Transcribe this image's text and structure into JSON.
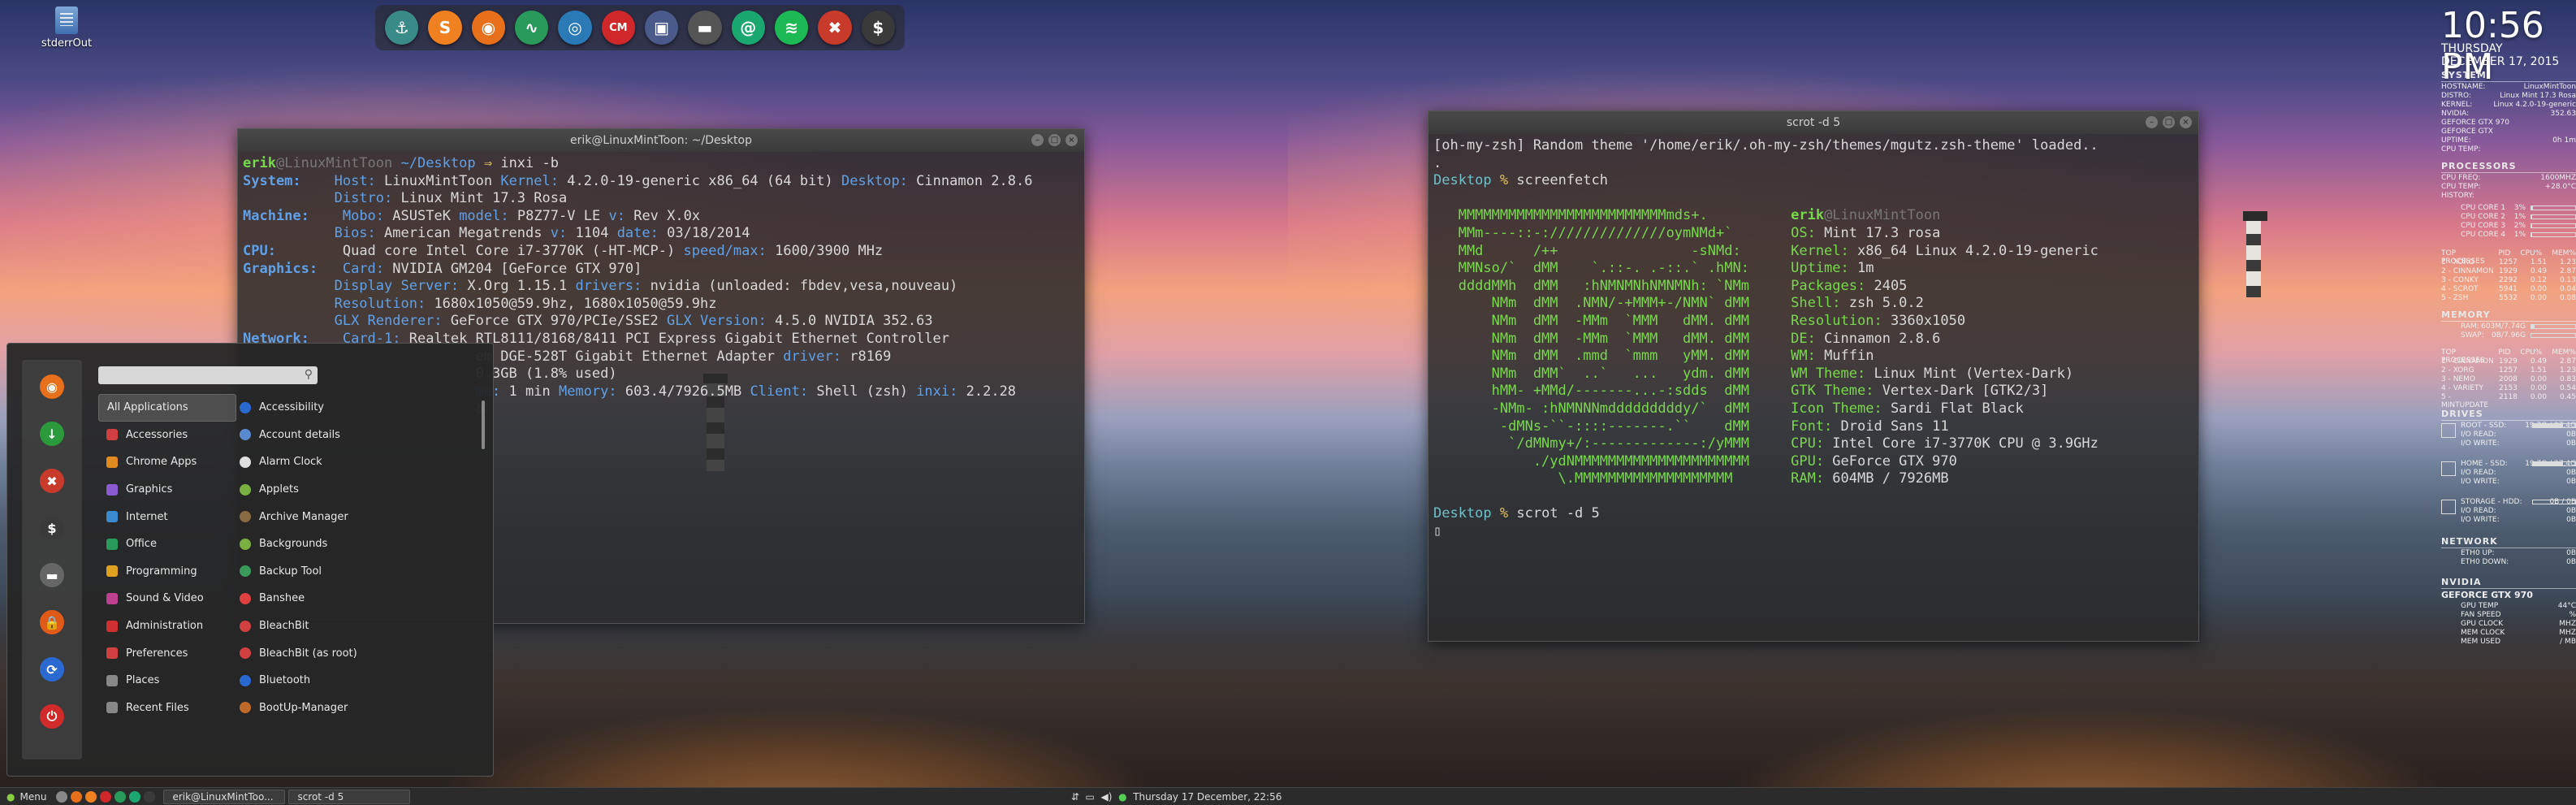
{
  "desktop": {
    "icon_label": "stderrOut"
  },
  "dock": {
    "icons": [
      {
        "name": "anchor-icon",
        "glyph": "⚓",
        "color": "#3a8a8a"
      },
      {
        "name": "sublime-icon",
        "glyph": "S",
        "color": "#f08020"
      },
      {
        "name": "firefox-icon",
        "glyph": "◉",
        "color": "#e8701a"
      },
      {
        "name": "system-monitor-icon",
        "glyph": "∿",
        "color": "#2a9a5a"
      },
      {
        "name": "camera-icon",
        "glyph": "◎",
        "color": "#2a7ab8"
      },
      {
        "name": "cm-icon",
        "glyph": "CM",
        "color": "#d0282a"
      },
      {
        "name": "screenshot-icon",
        "glyph": "▣",
        "color": "#4a5a8a"
      },
      {
        "name": "folder-icon",
        "glyph": "▬",
        "color": "#555555"
      },
      {
        "name": "email-icon",
        "glyph": "@",
        "color": "#1aa870"
      },
      {
        "name": "spotify-icon",
        "glyph": "≋",
        "color": "#1db954"
      },
      {
        "name": "tools-icon",
        "glyph": "✖",
        "color": "#c83a2a"
      },
      {
        "name": "terminal-icon",
        "glyph": "$",
        "color": "#3a3a3a"
      }
    ]
  },
  "term_left": {
    "title": "erik@LinuxMintToon: ~/Desktop",
    "prompt_user": "erik",
    "prompt_host": "@LinuxMintToon",
    "prompt_dir": " ~/Desktop ",
    "prompt_arrow": "⇒",
    "cmd": " inxi -b",
    "sys_label": "System:",
    "host_k": "Host:",
    "host_v": "LinuxMintToon",
    "kernel_k": "Kernel:",
    "kernel_v": "4.2.0-19-generic x86_64 (64 bit)",
    "desktop_k": "Desktop:",
    "desktop_v": "Cinnamon 2.8.6",
    "distro_k": "Distro:",
    "distro_v": "Linux Mint 17.3 Rosa",
    "mach_label": "Machine:",
    "mobo_k": "Mobo:",
    "mobo_v": "ASUSTeK",
    "model_k": "model:",
    "model_v": "P8Z77-V LE",
    "v_k": "v:",
    "v_v": "Rev X.0x",
    "bios_k": "Bios:",
    "bios_v": "American Megatrends",
    "bv_k": "v:",
    "bv_v": "1104",
    "date_k": "date:",
    "date_v": "03/18/2014",
    "cpu_label": "CPU:",
    "cpu_v": "Quad core Intel Core i7-3770K (-HT-MCP-)",
    "speed_k": "speed/max:",
    "speed_v": "1600/3900 MHz",
    "gfx_label": "Graphics:",
    "card_k": "Card:",
    "card_v": "NVIDIA GM204 [GeForce GTX 970]",
    "ds_k": "Display Server:",
    "ds_v": "X.Org 1.15.1",
    "drv_k": "drivers:",
    "drv_v": "nvidia (unloaded: fbdev,vesa,nouveau)",
    "res_k": "Resolution:",
    "res_v": "1680x1050@59.9hz, 1680x1050@59.9hz",
    "glx_k": "GLX Renderer:",
    "glx_v": "GeForce GTX 970/PCIe/SSE2",
    "glxv_k": "GLX Version:",
    "glxv_v": "4.5.0 NVIDIA 352.63",
    "net_label": "Network:",
    "card1_k": "Card-1:",
    "card1_v": "Realtek RTL8111/8168/8411 PCI Express Gigabit Ethernet Controller",
    "card2_v": "em DGE-528T Gigabit Ethernet Adapter",
    "card2_drv_k": "driver:",
    "card2_drv_v": "r8169",
    "hdd_v": "0.3GB (1.8% used)",
    "uptime_k": "me:",
    "uptime_v": "1 min",
    "mem_k": "Memory:",
    "mem_v": "603.4/7926.5MB",
    "client_k": "Client:",
    "client_v": "Shell (zsh)",
    "inxi_k": "inxi:",
    "inxi_v": "2.2.28"
  },
  "menu": {
    "categories": [
      "All Applications",
      "Accessories",
      "Chrome Apps",
      "Graphics",
      "Internet",
      "Office",
      "Programming",
      "Sound & Video",
      "Administration",
      "Preferences",
      "Places",
      "Recent Files"
    ],
    "apps": [
      "Accessibility",
      "Account details",
      "Alarm Clock",
      "Applets",
      "Archive Manager",
      "Backgrounds",
      "Backup Tool",
      "Banshee",
      "BleachBit",
      "BleachBit (as root)",
      "Bluetooth",
      "BootUp-Manager"
    ],
    "favorites": [
      {
        "name": "firefox-fav-icon",
        "glyph": "◉",
        "color": "#e8701a"
      },
      {
        "name": "download-fav-icon",
        "glyph": "↓",
        "color": "#2a9a3a"
      },
      {
        "name": "tools-fav-icon",
        "glyph": "✖",
        "color": "#c83a2a"
      },
      {
        "name": "terminal-fav-icon",
        "glyph": "$",
        "color": "#3a3a3a"
      },
      {
        "name": "files-fav-icon",
        "glyph": "▬",
        "color": "#666666"
      },
      {
        "name": "lock-fav-icon",
        "glyph": "🔒",
        "color": "#e05a1a"
      },
      {
        "name": "logout-fav-icon",
        "glyph": "⟳",
        "color": "#2a6ad0"
      },
      {
        "name": "power-fav-icon",
        "glyph": "⏻",
        "color": "#d02a2a"
      }
    ]
  },
  "panel_left": {
    "menu_label": "Menu",
    "task1": "erik@LinuxMintToo...",
    "task2": "scrot -d 5",
    "clock": "Thursday 17 December, 22:56"
  },
  "term_right": {
    "title": "scrot -d 5",
    "line1": "[oh-my-zsh] Random theme '/home/erik/.oh-my-zsh/themes/mgutz.zsh-theme' loaded..",
    "line2": ".",
    "prompt1_dir": "Desktop",
    "prompt1_sym": "%",
    "cmd1": "screenfetch",
    "ascii": [
      "MMMMMMMMMMMMMMMMMMMMMMMMMmds+.",
      "MMm----::-://////////////oymNMd+`",
      "MMd      /++                -sNMd:",
      "MMNso/`  dMM    `.::-. .-::.` .hMN:",
      "ddddMMh  dMM   :hNMNMNhNMNMNh: `NMm",
      "    NMm  dMM  .NMN/-+MMM+-/NMN` dMM",
      "    NMm  dMM  -MMm  `MMM   dMM. dMM",
      "    NMm  dMM  -MMm  `MMM   dMM. dMM",
      "    NMm  dMM  .mmd  `mmm   yMM. dMM",
      "    NMm  dMM`  ..`   ...   ydm. dMM",
      "    hMM- +MMd/-------...-:sdds  dMM",
      "    -NMm- :hNMNNNmdddddddddy/`  dMM",
      "     -dMNs-``-::::-------.``    dMM",
      "      `/dMNmy+/:-------------:/yMMM",
      "         ./ydNMMMMMMMMMMMMMMMMMMMMM",
      "            \\.MMMMMMMMMMMMMMMMMMM"
    ],
    "info_user": "erik",
    "info_host": "@LinuxMintToon",
    "info": [
      [
        "OS:",
        "Mint 17.3 rosa"
      ],
      [
        "Kernel:",
        "x86_64 Linux 4.2.0-19-generic"
      ],
      [
        "Uptime:",
        "1m"
      ],
      [
        "Packages:",
        "2405"
      ],
      [
        "Shell:",
        "zsh 5.0.2"
      ],
      [
        "Resolution:",
        "3360x1050"
      ],
      [
        "DE:",
        "Cinnamon 2.8.6"
      ],
      [
        "WM:",
        "Muffin"
      ],
      [
        "WM Theme:",
        "Linux Mint (Vertex-Dark)"
      ],
      [
        "GTK Theme:",
        "Vertex-Dark [GTK2/3]"
      ],
      [
        "Icon Theme:",
        "Sardi Flat Black"
      ],
      [
        "Font:",
        "Droid Sans 11"
      ],
      [
        "CPU:",
        "Intel Core i7-3770K CPU @ 3.9GHz"
      ],
      [
        "GPU:",
        "GeForce GTX 970"
      ],
      [
        "RAM:",
        "604MB / 7926MB"
      ]
    ],
    "prompt2_dir": "Desktop",
    "prompt2_sym": "%",
    "cmd2": "scrot -d 5"
  },
  "conky": {
    "time": "10:56 PM",
    "date": "THURSDAY DECEMBER 17, 2015",
    "system_title": "SYSTEM",
    "system_rows": [
      [
        "HOSTNAME:",
        "LinuxMintToon"
      ],
      [
        "DISTRO:",
        "Linux Mint 17.3 Rosa"
      ],
      [
        "KERNEL:",
        "Linux 4.2.0-19-generic"
      ],
      [
        "NVIDIA:",
        "352.63"
      ],
      [
        "GEFORCE GTX 970",
        ""
      ],
      [
        "GEFORCE GTX",
        ""
      ],
      [
        "UPTIME:",
        "0h 1m"
      ],
      [
        "CPU TEMP:",
        ""
      ]
    ],
    "processors_title": "PROCESSORS",
    "cpu_rows": [
      [
        "CPU FREQ:",
        "1600MHZ"
      ],
      [
        "CPU TEMP:",
        "+28.0°C"
      ],
      [
        "HISTORY:",
        ""
      ]
    ],
    "cores": [
      [
        "CPU CORE 1",
        "3%",
        0.03
      ],
      [
        "CPU CORE 2",
        "1%",
        0.01
      ],
      [
        "CPU CORE 3",
        "2%",
        0.02
      ],
      [
        "CPU CORE 4",
        "1%",
        0.01
      ]
    ],
    "top_head": [
      "TOP PROCESSES",
      "PID",
      "CPU%",
      "MEM%"
    ],
    "top_cpu": [
      [
        "1 - XORG",
        "1257",
        "1.51",
        "1.23"
      ],
      [
        "2 - CINNAMON",
        "1929",
        "0.49",
        "2.87"
      ],
      [
        "3 - CONKY",
        "2292",
        "0.12",
        "0.13"
      ],
      [
        "4 - SCROT",
        "5941",
        "0.00",
        "0.04"
      ],
      [
        "5 - ZSH",
        "5532",
        "0.00",
        "0.08"
      ]
    ],
    "memory_title": "MEMORY",
    "mem_rows": [
      [
        "RAM:",
        "603M/7.74G",
        0.08
      ],
      [
        "SWAP:",
        "0B/7.96G",
        0.0
      ]
    ],
    "top_mem_head": [
      "TOP PROCESSES",
      "PID",
      "CPU%",
      "MEM%"
    ],
    "top_mem": [
      [
        "1 - CINNAMON",
        "1929",
        "0.49",
        "2.87"
      ],
      [
        "2 - XORG",
        "1257",
        "1.51",
        "1.23"
      ],
      [
        "3 - NEMO",
        "2008",
        "0.00",
        "0.83"
      ],
      [
        "4 - VARIETY",
        "2153",
        "0.00",
        "0.54"
      ],
      [
        "5 - MINTUPDATE",
        "2118",
        "0.00",
        "0.45"
      ]
    ],
    "drives_title": "DRIVES",
    "drives": [
      {
        "name": "ROOT - SSD:",
        "size": "19.7G / 27.4G",
        "read": "0B",
        "write": "0B",
        "fill": 0.72
      },
      {
        "name": "HOME - SSD:",
        "size": "19.7G / 27.4G",
        "read": "0B",
        "write": "0B",
        "fill": 0.72
      },
      {
        "name": "STORAGE - HDD:",
        "size": "0B / 0B",
        "read": "0B",
        "write": "0B",
        "fill": 0.0
      }
    ],
    "read_label": "I/O READ:",
    "write_label": "I/O WRITE:",
    "network_title": "NETWORK",
    "net_rows": [
      [
        "ETH0 UP:",
        "0B"
      ],
      [
        "ETH0 DOWN:",
        "0B"
      ]
    ],
    "nvidia_title": "NVIDIA",
    "gpu_name": "GEFORCE GTX 970",
    "gpu_rows": [
      [
        "GPU TEMP",
        "44°C"
      ],
      [
        "FAN SPEED",
        "%"
      ],
      [
        "GPU CLOCK",
        "MHZ"
      ],
      [
        "MEM CLOCK",
        "MHZ"
      ],
      [
        "MEM USED",
        "/ MB"
      ]
    ]
  },
  "panel_right": {
    "label": ""
  }
}
